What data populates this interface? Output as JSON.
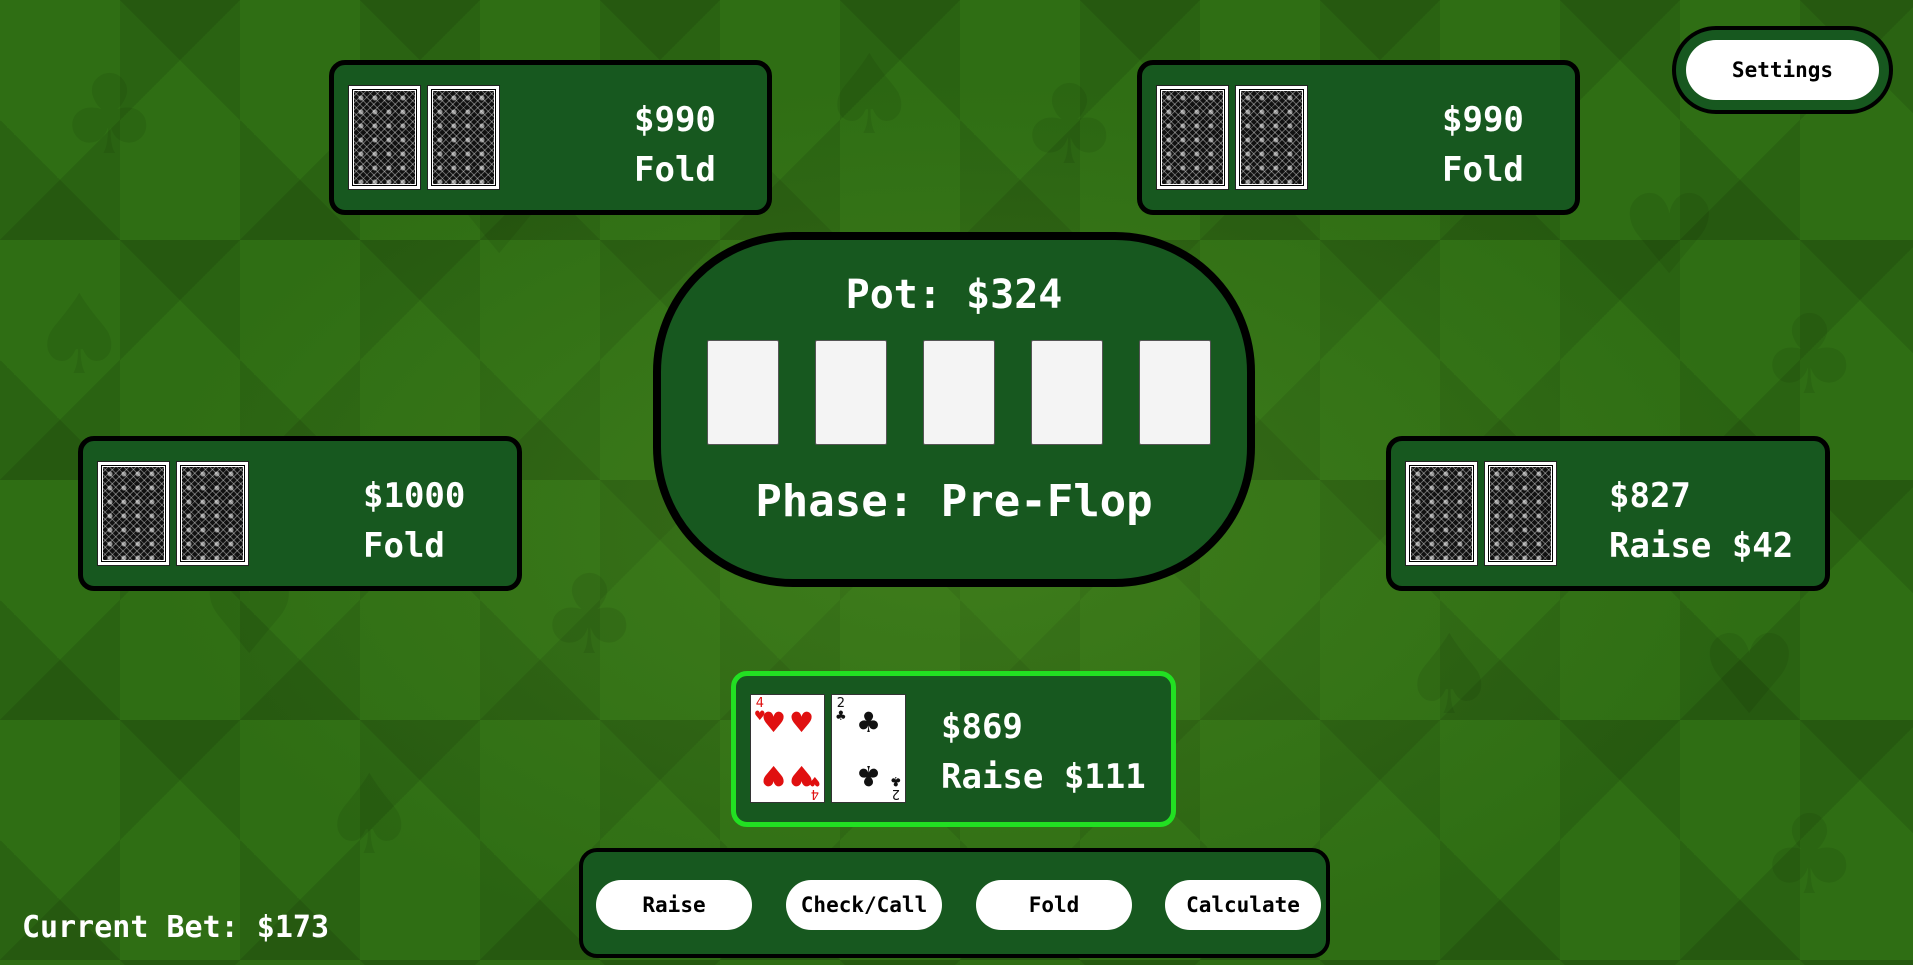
{
  "background": {
    "felt_color": "#2f6e14",
    "panel_color": "#17581f",
    "active_border_color": "#22e022"
  },
  "opponents": [
    {
      "id": "top-left",
      "money": "$990",
      "status": "Fold"
    },
    {
      "id": "top-right",
      "money": "$990",
      "status": "Fold"
    },
    {
      "id": "mid-left",
      "money": "$1000",
      "status": "Fold"
    },
    {
      "id": "mid-right",
      "money": "$827",
      "status": "Raise $42"
    }
  ],
  "table": {
    "pot": "Pot: $324",
    "phase": "Phase: Pre-Flop",
    "community_cards": [
      "empty",
      "empty",
      "empty",
      "empty",
      "empty"
    ]
  },
  "player": {
    "money": "$869",
    "status": "Raise $111",
    "cards": [
      {
        "rank": "4",
        "suit": "♥",
        "color": "red"
      },
      {
        "rank": "2",
        "suit": "♣",
        "color": "black"
      }
    ]
  },
  "actions": {
    "raise": "Raise",
    "check_call": "Check/Call",
    "fold": "Fold",
    "calculate": "Calculate"
  },
  "settings_label": "Settings",
  "current_bet": "Current Bet: $173"
}
